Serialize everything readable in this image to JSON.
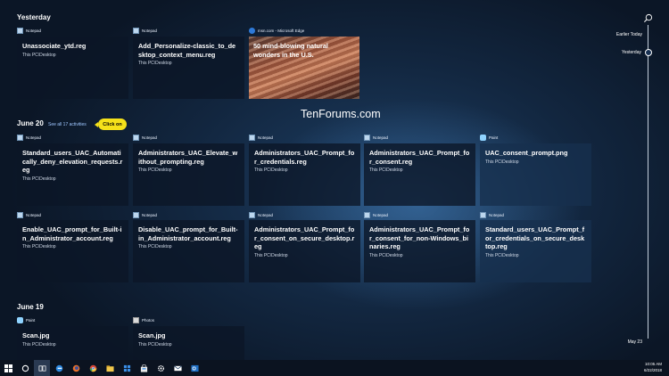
{
  "sections": {
    "yesterday": "Yesterday",
    "june20": "June 20",
    "june20_see_all": "See all 17 activities",
    "june19": "June 19"
  },
  "callout": "Click on",
  "watermark": "TenForums.com",
  "apps": {
    "notepad": "Notepad",
    "edge": "msn.com - Microsoft Edge",
    "paint": "Paint",
    "photos": "Photos"
  },
  "subtitle": "This PC\\Desktop",
  "yesterday_cards": [
    {
      "title": "Unassociate_ytd.reg"
    },
    {
      "title": "Add_Personalize-classic_to_desktop_context_menu.reg"
    },
    {
      "title": "50 mind-blowing natural wonders in the U.S."
    }
  ],
  "june20_cards": [
    {
      "title": "Standard_users_UAC_Automatically_deny_elevation_requests.reg"
    },
    {
      "title": "Administrators_UAC_Elevate_without_prompting.reg"
    },
    {
      "title": "Administrators_UAC_Prompt_for_credentials.reg"
    },
    {
      "title": "Administrators_UAC_Prompt_for_consent.reg"
    },
    {
      "title": "UAC_consent_prompt.png"
    },
    {
      "title": "Enable_UAC_prompt_for_Built-in_Administrator_account.reg"
    },
    {
      "title": "Disable_UAC_prompt_for_Built-in_Administrator_account.reg"
    },
    {
      "title": "Administrators_UAC_Prompt_for_consent_on_secure_desktop.reg"
    },
    {
      "title": "Administrators_UAC_Prompt_for_consent_for_non-Windows_binaries.reg"
    },
    {
      "title": "Standard_users_UAC_Prompt_for_credentials_on_secure_desktop.reg"
    }
  ],
  "june19_cards": [
    {
      "title": "Scan.jpg"
    },
    {
      "title": "Scan.jpg"
    }
  ],
  "timeline": {
    "earlier_today": "Earlier Today",
    "yesterday": "Yesterday",
    "may23": "May 23"
  },
  "tray": {
    "time": "10:05 AM",
    "date": "6/22/2018"
  },
  "taskbar_icons": [
    "start-icon",
    "cortana-icon",
    "task-view-icon",
    "edge-icon",
    "firefox-icon",
    "chrome-icon",
    "file-explorer-icon",
    "windows-store-icon",
    "store-bag-icon",
    "settings-icon",
    "mail-icon",
    "outlook-icon"
  ]
}
